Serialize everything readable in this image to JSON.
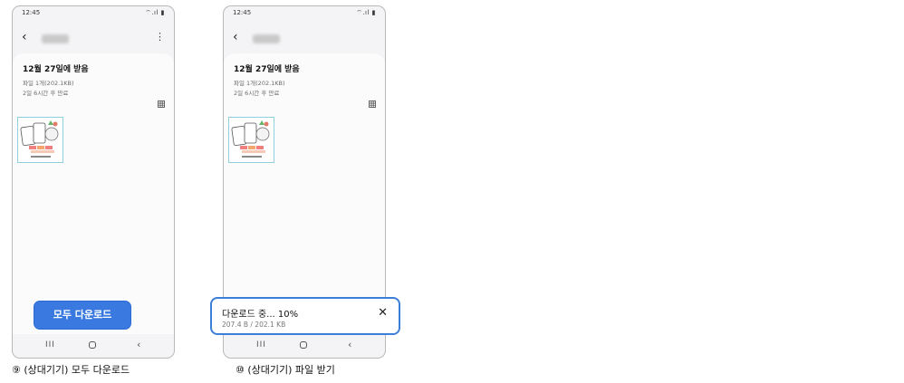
{
  "status": {
    "time": "12:45",
    "icons": "⌔.ıl ▮"
  },
  "header": {
    "back_glyph": "‹",
    "more_glyph": "⋮"
  },
  "transfer": {
    "title": "12월 27일에 받음",
    "files": "파일 1개(202.1KB)",
    "expiry": "2일 6시간 후 만료"
  },
  "screen1": {
    "download_all_button": "모두 다운로드"
  },
  "screen2": {
    "progress_title": "다운로드 중... 10%",
    "progress_size": "207.4 B / 202.1 KB",
    "progress_percent": 10,
    "close_glyph": "✕"
  },
  "navbar": {
    "recent_glyph": "III",
    "back_glyph": "‹"
  },
  "captions": {
    "step9": "⑨ (상대기기) 모두 다운로드",
    "step10": "⑩ (상대기기) 파일  받기"
  },
  "colors": {
    "accent": "#3a7ae0",
    "toast_border": "#3c7fd9"
  }
}
